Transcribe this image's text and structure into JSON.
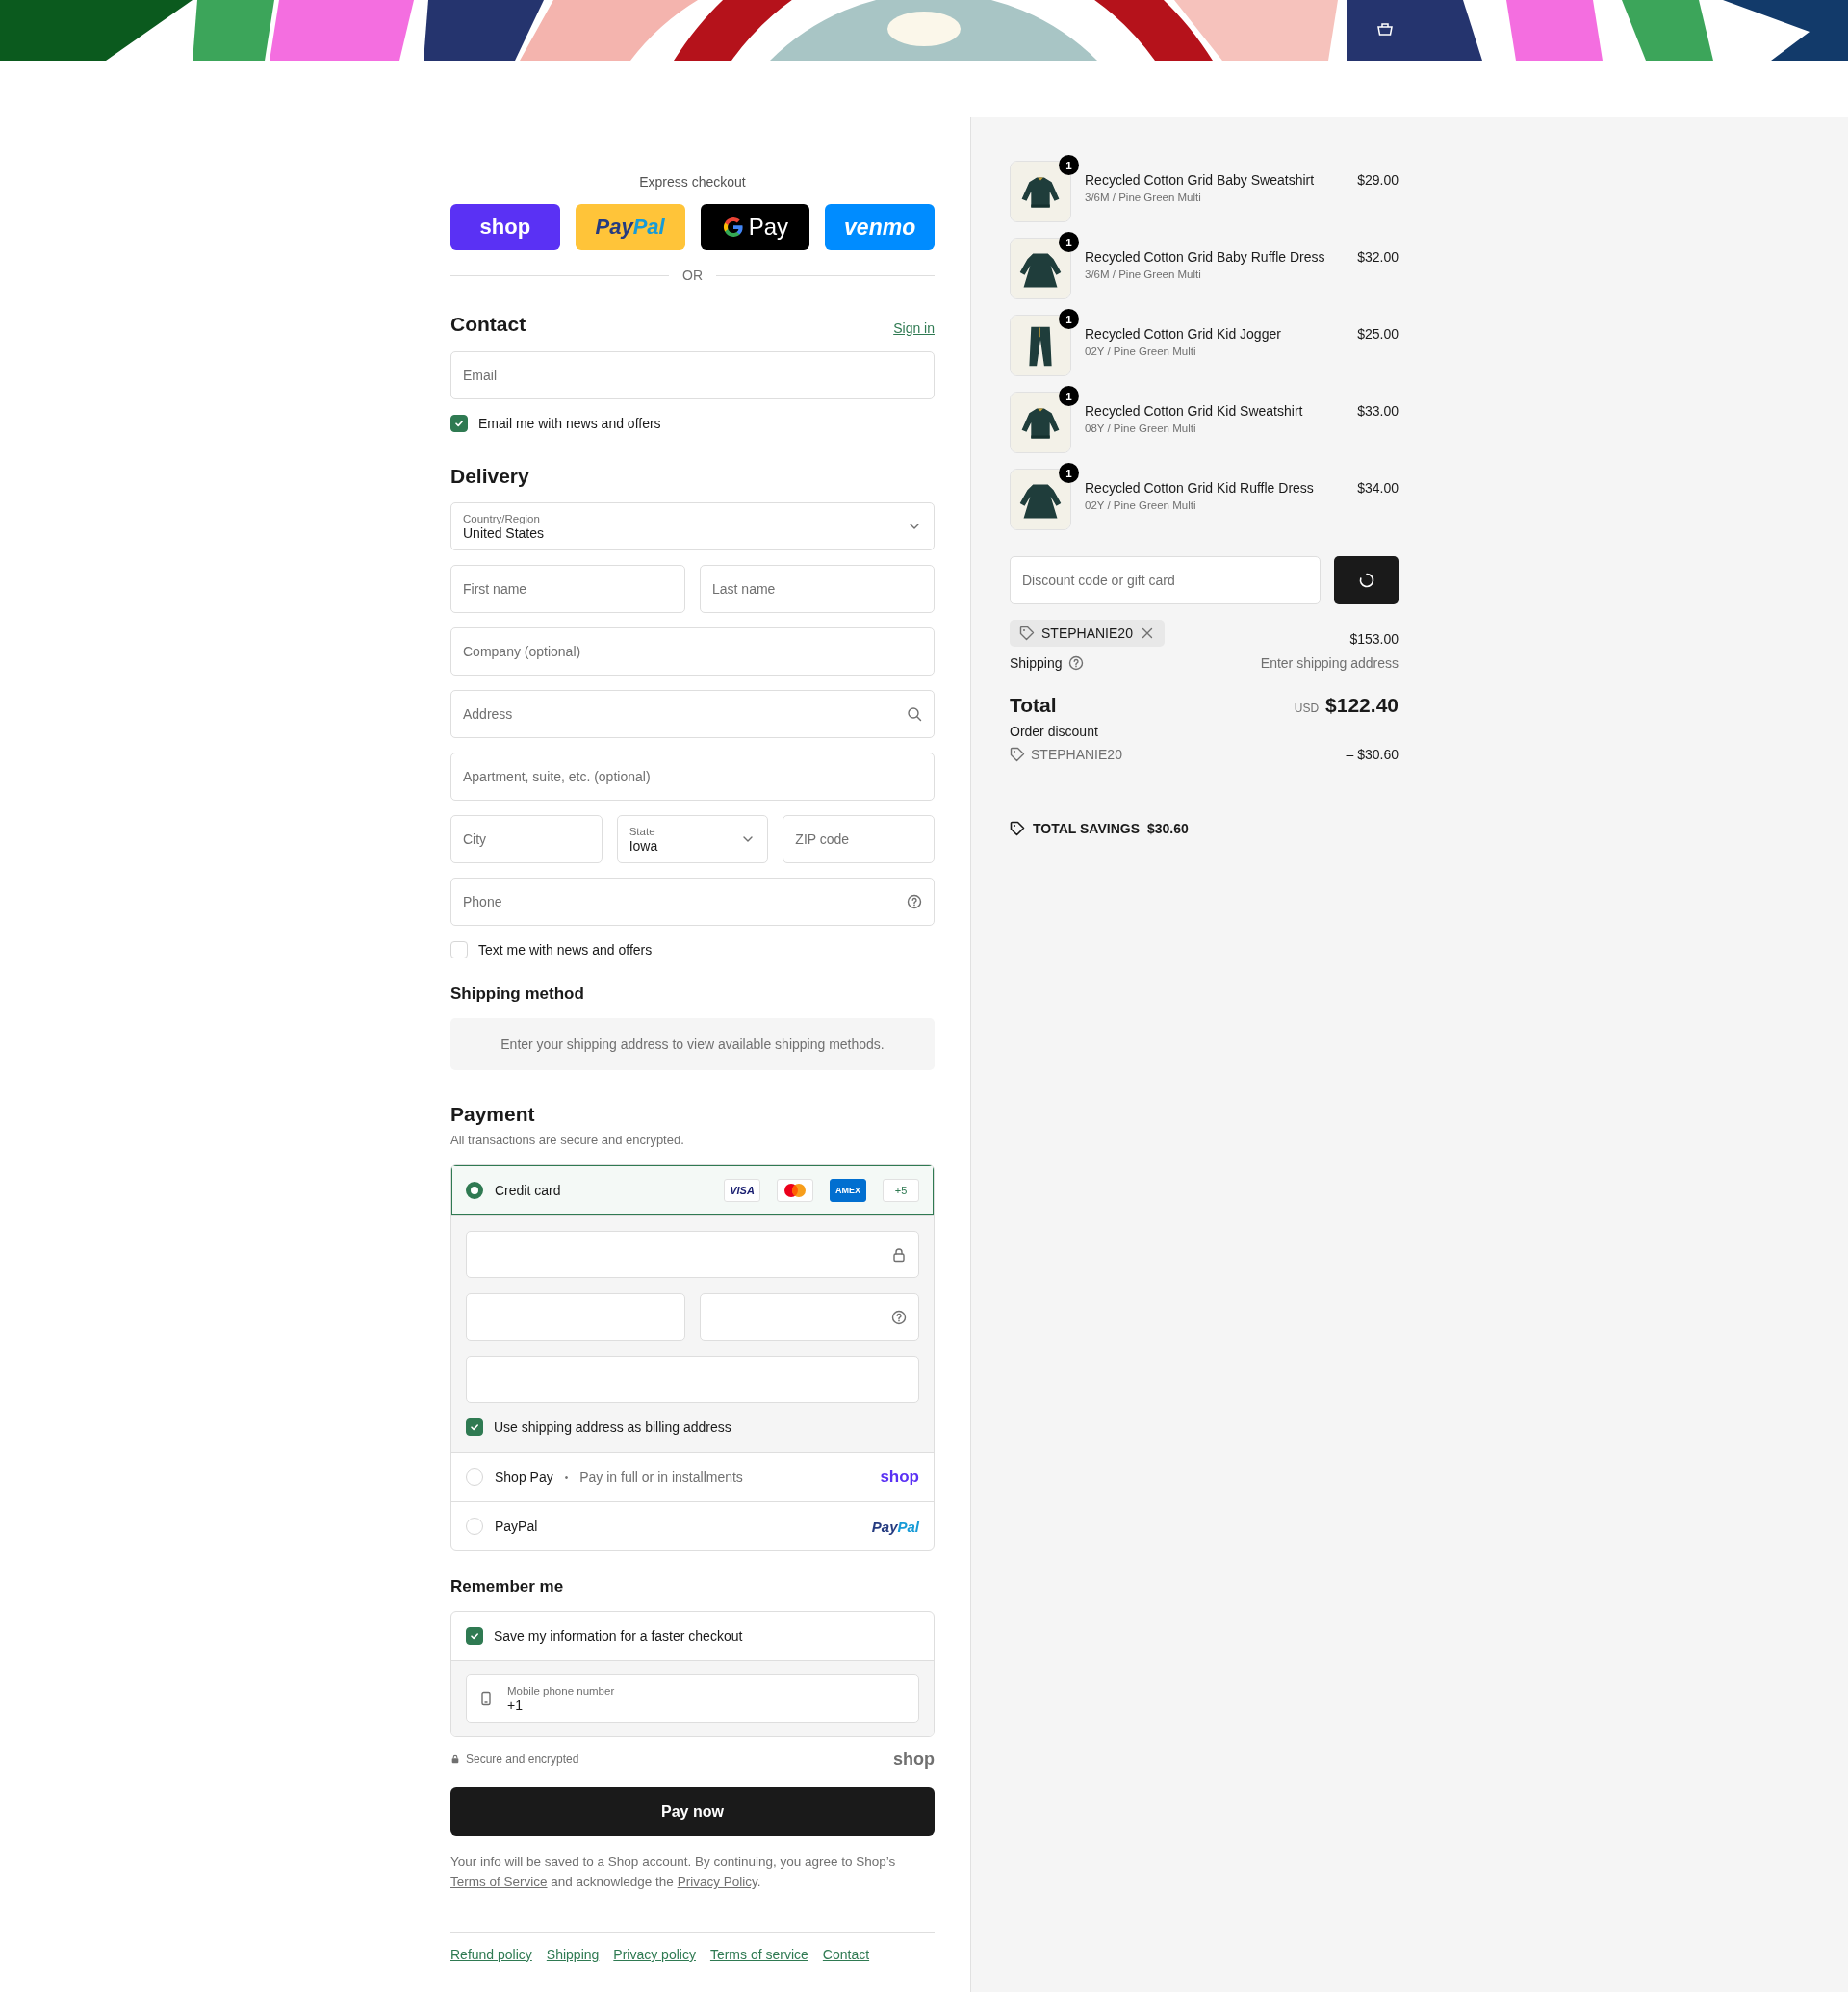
{
  "express_checkout": {
    "label": "Express checkout",
    "buttons": [
      {
        "kind": "shop",
        "label": "shop"
      },
      {
        "kind": "paypal",
        "label_parts": [
          "Pay",
          "Pal"
        ]
      },
      {
        "kind": "gpay",
        "label": "Pay"
      },
      {
        "kind": "venmo",
        "label": "venmo"
      }
    ],
    "divider": "OR"
  },
  "contact": {
    "heading": "Contact",
    "sign_in": "Sign in",
    "email": {
      "placeholder": "Email"
    },
    "newsletter": {
      "label": "Email me with news and offers",
      "checked": true
    }
  },
  "delivery": {
    "heading": "Delivery",
    "rows": [
      [
        {
          "kind": "select",
          "label": "Country/Region",
          "value": "United States"
        }
      ],
      [
        {
          "kind": "text",
          "placeholder": "First name"
        },
        {
          "kind": "text",
          "placeholder": "Last name"
        }
      ],
      [
        {
          "kind": "text",
          "placeholder": "Company (optional)"
        }
      ],
      [
        {
          "kind": "search",
          "placeholder": "Address"
        }
      ],
      [
        {
          "kind": "text",
          "placeholder": "Apartment, suite, etc. (optional)"
        }
      ],
      [
        {
          "kind": "text",
          "placeholder": "City"
        },
        {
          "kind": "select",
          "label": "State",
          "value": "Iowa"
        },
        {
          "kind": "text",
          "placeholder": "ZIP code"
        }
      ],
      [
        {
          "kind": "help",
          "placeholder": "Phone"
        }
      ]
    ],
    "sms": {
      "label": "Text me with news and offers",
      "checked": false
    }
  },
  "shipping_method": {
    "heading": "Shipping method",
    "message": "Enter your shipping address to view available shipping methods."
  },
  "payment": {
    "heading": "Payment",
    "subtitle": "All transactions are secure and encrypted.",
    "methods": [
      {
        "kind": "card",
        "label": "Credit card",
        "selected": true,
        "brands": [
          {
            "kind": "visa",
            "label": "VISA"
          },
          {
            "kind": "mastercard"
          },
          {
            "kind": "amex",
            "label": "AMEX"
          },
          {
            "kind": "more",
            "label": "+5"
          }
        ],
        "billing": {
          "label": "Use shipping address as billing address",
          "checked": true
        }
      },
      {
        "kind": "shop_pay",
        "label": "Shop Pay",
        "separator": "•",
        "note": "Pay in full or in installments",
        "logo": "shop",
        "selected": false
      },
      {
        "kind": "paypal",
        "label": "PayPal",
        "logo_parts": [
          "Pay",
          "Pal"
        ],
        "selected": false
      }
    ]
  },
  "remember_me": {
    "heading": "Remember me",
    "save": {
      "label": "Save my information for a faster checkout",
      "checked": true
    },
    "phone": {
      "label": "Mobile phone number",
      "value": "+1"
    }
  },
  "secure_note": "Secure and encrypted",
  "shop_logo": "shop",
  "pay_button": "Pay now",
  "legal": [
    {
      "kind": "text",
      "text": "Your info will be saved to a Shop account. By continuing, you agree to Shop’s "
    },
    {
      "kind": "link",
      "text": "Terms of Service"
    },
    {
      "kind": "text",
      "text": " and acknowledge the "
    },
    {
      "kind": "link",
      "text": "Privacy Policy"
    },
    {
      "kind": "text",
      "text": "."
    }
  ],
  "footer_links": [
    "Refund policy",
    "Shipping",
    "Privacy policy",
    "Terms of service",
    "Contact"
  ],
  "summary": {
    "items": [
      {
        "name": "Recycled Cotton Grid Baby Sweatshirt",
        "variant": "3/6M / Pine Green Multi",
        "price": "$29.00",
        "quantity": "1"
      },
      {
        "name": "Recycled Cotton Grid Baby Ruffle Dress",
        "variant": "3/6M / Pine Green Multi",
        "price": "$32.00",
        "quantity": "1"
      },
      {
        "name": "Recycled Cotton Grid Kid Jogger",
        "variant": "02Y / Pine Green Multi",
        "price": "$25.00",
        "quantity": "1"
      },
      {
        "name": "Recycled Cotton Grid Kid Sweatshirt",
        "variant": "08Y / Pine Green Multi",
        "price": "$33.00",
        "quantity": "1"
      },
      {
        "name": "Recycled Cotton Grid Kid Ruffle Dress",
        "variant": "02Y / Pine Green Multi",
        "price": "$34.00",
        "quantity": "1"
      }
    ],
    "discount": {
      "placeholder": "Discount code or gift card"
    },
    "applied_code": "STEPHANIE20",
    "subtotal": "$153.00",
    "shipping": {
      "label": "Shipping",
      "value": "Enter shipping address"
    },
    "total": {
      "label": "Total",
      "currency": "USD",
      "amount": "$122.40"
    },
    "order_discount": {
      "label": "Order discount",
      "code": "STEPHANIE20",
      "amount": "– $30.60"
    },
    "savings": {
      "label": "TOTAL SAVINGS",
      "amount": "$30.60"
    }
  }
}
